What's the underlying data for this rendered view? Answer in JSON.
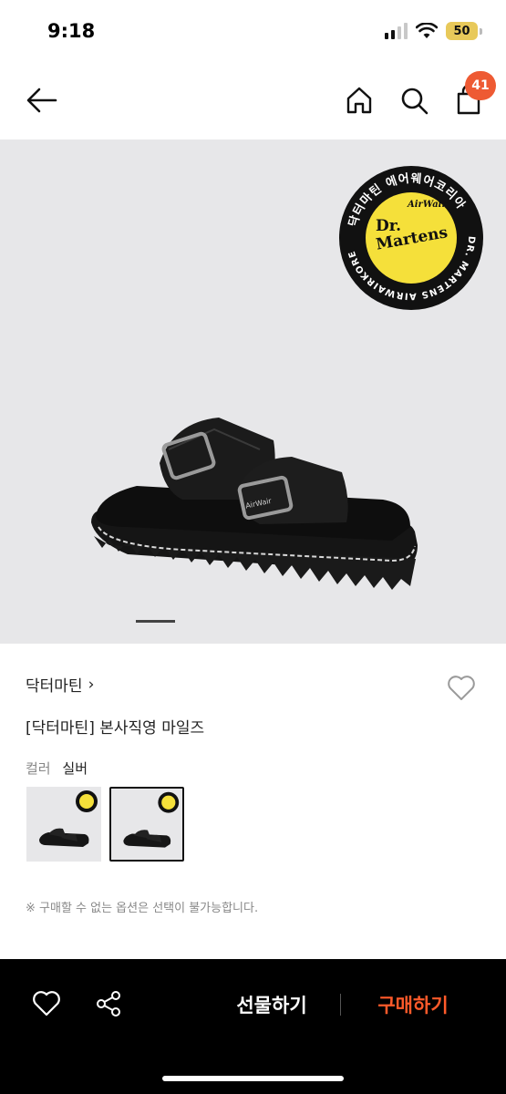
{
  "status_bar": {
    "time": "9:18",
    "battery": "50"
  },
  "nav": {
    "cart_count": "41"
  },
  "hero": {
    "badge_top_text": "닥터마틴 에어웨어코리아",
    "badge_side_text": "DR. MARTENS AIRWAIRKOREA",
    "badge_logo_small": "AirWair",
    "badge_logo_line1": "Dr.",
    "badge_logo_line2": "Martens",
    "buckle_text": "AirWair",
    "colors": {
      "badge_yellow": "#f5e03a",
      "badge_black": "#111111"
    }
  },
  "product": {
    "brand": "닥터마틴",
    "brand_chevron": "›",
    "title": "[닥터마틴] 본사직영 마일즈",
    "color_label": "컬러",
    "color_value": "실버",
    "notice": "※ 구매할 수 없는 옵션은 선택이 불가능합니다."
  },
  "bottom_bar": {
    "gift_label": "선물하기",
    "buy_label": "구매하기",
    "colors": {
      "buy": "#ff5a2a"
    }
  }
}
